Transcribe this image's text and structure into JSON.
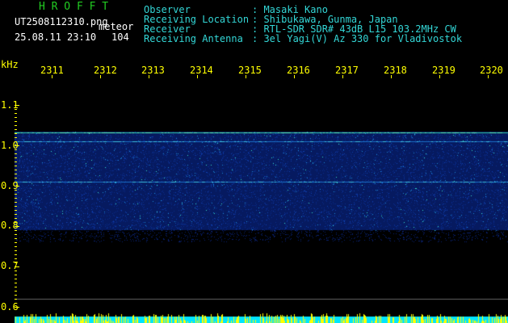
{
  "header": {
    "app_title": "H R O F F T",
    "filename": "UT2508112310.png",
    "meteor_label": "meteor",
    "timestamp": "25.08.11 23:10",
    "count": "104"
  },
  "info": {
    "labels": [
      "Observer",
      "Receiving Location",
      "Receiver",
      "Receiving Antenna"
    ],
    "values": [
      ": Masaki Kano",
      ": Shibukawa, Gunma, Japan",
      ": RTL-SDR SDR# 43dB L15 103.2MHz CW",
      ": 3el Yagi(V) Az 330 for Vladivostok"
    ]
  },
  "axis": {
    "y_unit": "kHz",
    "y_ticks": [
      "1.1",
      "1.0",
      "0.9",
      "0.8",
      "0.7",
      "0.6"
    ],
    "x_ticks": [
      "2311",
      "2312",
      "2313",
      "2314",
      "2315",
      "2316",
      "2317",
      "2318",
      "2319",
      "2320"
    ]
  },
  "colors": {
    "background": "#000000",
    "title": "#22cc22",
    "info": "#33d6d6",
    "axis": "#ffff00",
    "signal": "#0a2a8a"
  },
  "spectrogram": {
    "band_top_khz": 1.035,
    "band_bottom_khz": 0.79,
    "bright_lines_khz": [
      1.033,
      1.01,
      0.91
    ]
  }
}
